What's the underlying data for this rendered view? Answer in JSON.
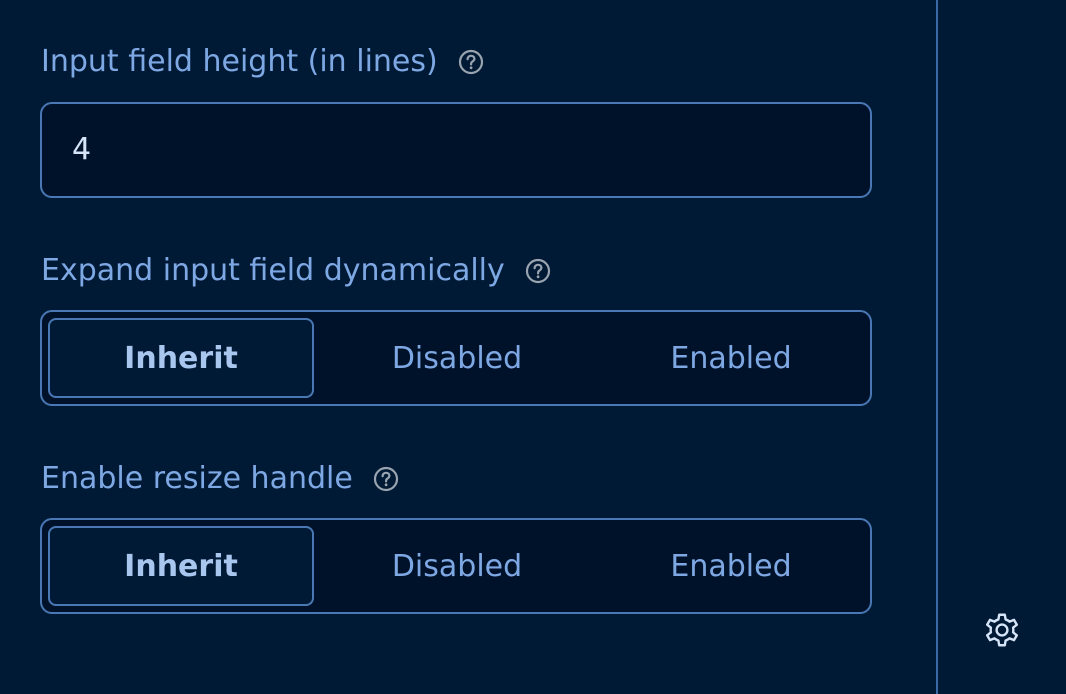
{
  "settings": [
    {
      "label": "Input field height (in lines)",
      "help_icon": "question-circle-icon",
      "control": "number-input",
      "value": "4"
    },
    {
      "label": "Expand input field dynamically",
      "help_icon": "question-circle-icon",
      "control": "segmented",
      "options": [
        "Inherit",
        "Disabled",
        "Enabled"
      ],
      "selected": "Inherit"
    },
    {
      "label": "Enable resize handle",
      "help_icon": "question-circle-icon",
      "control": "segmented",
      "options": [
        "Inherit",
        "Disabled",
        "Enabled"
      ],
      "selected": "Inherit"
    }
  ],
  "side_rail": {
    "settings_icon": "gear-icon"
  },
  "colors": {
    "background": "#001a35",
    "field_background": "#00122a",
    "border": "#4a78b5",
    "label_text": "#7ea8e4",
    "value_text": "#d6e4f7",
    "selected_text": "#a9c6ef",
    "icon_gray": "#9aa4b0"
  }
}
